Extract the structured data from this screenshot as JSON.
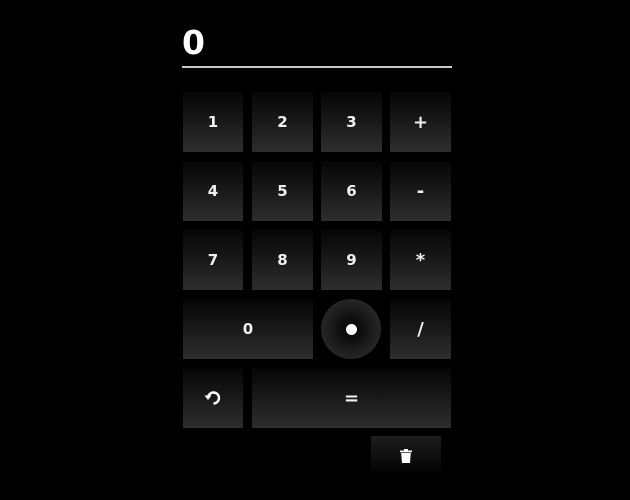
{
  "display": {
    "value": "0"
  },
  "keys": {
    "k1": "1",
    "k2": "2",
    "k3": "3",
    "plus": "+",
    "k4": "4",
    "k5": "5",
    "k6": "6",
    "minus": "-",
    "k7": "7",
    "k8": "8",
    "k9": "9",
    "multiply": "*",
    "k0": "0",
    "divide": "/",
    "equals": "="
  },
  "icons": {
    "decimal": "dot-icon",
    "undo": "undo-icon",
    "clear": "trash-icon"
  },
  "colors": {
    "background": "#000000",
    "key_top": "#050505",
    "key_bottom": "#2e2e2e",
    "text": "#f0f0f0",
    "display_rule": "#c8c8c8"
  }
}
